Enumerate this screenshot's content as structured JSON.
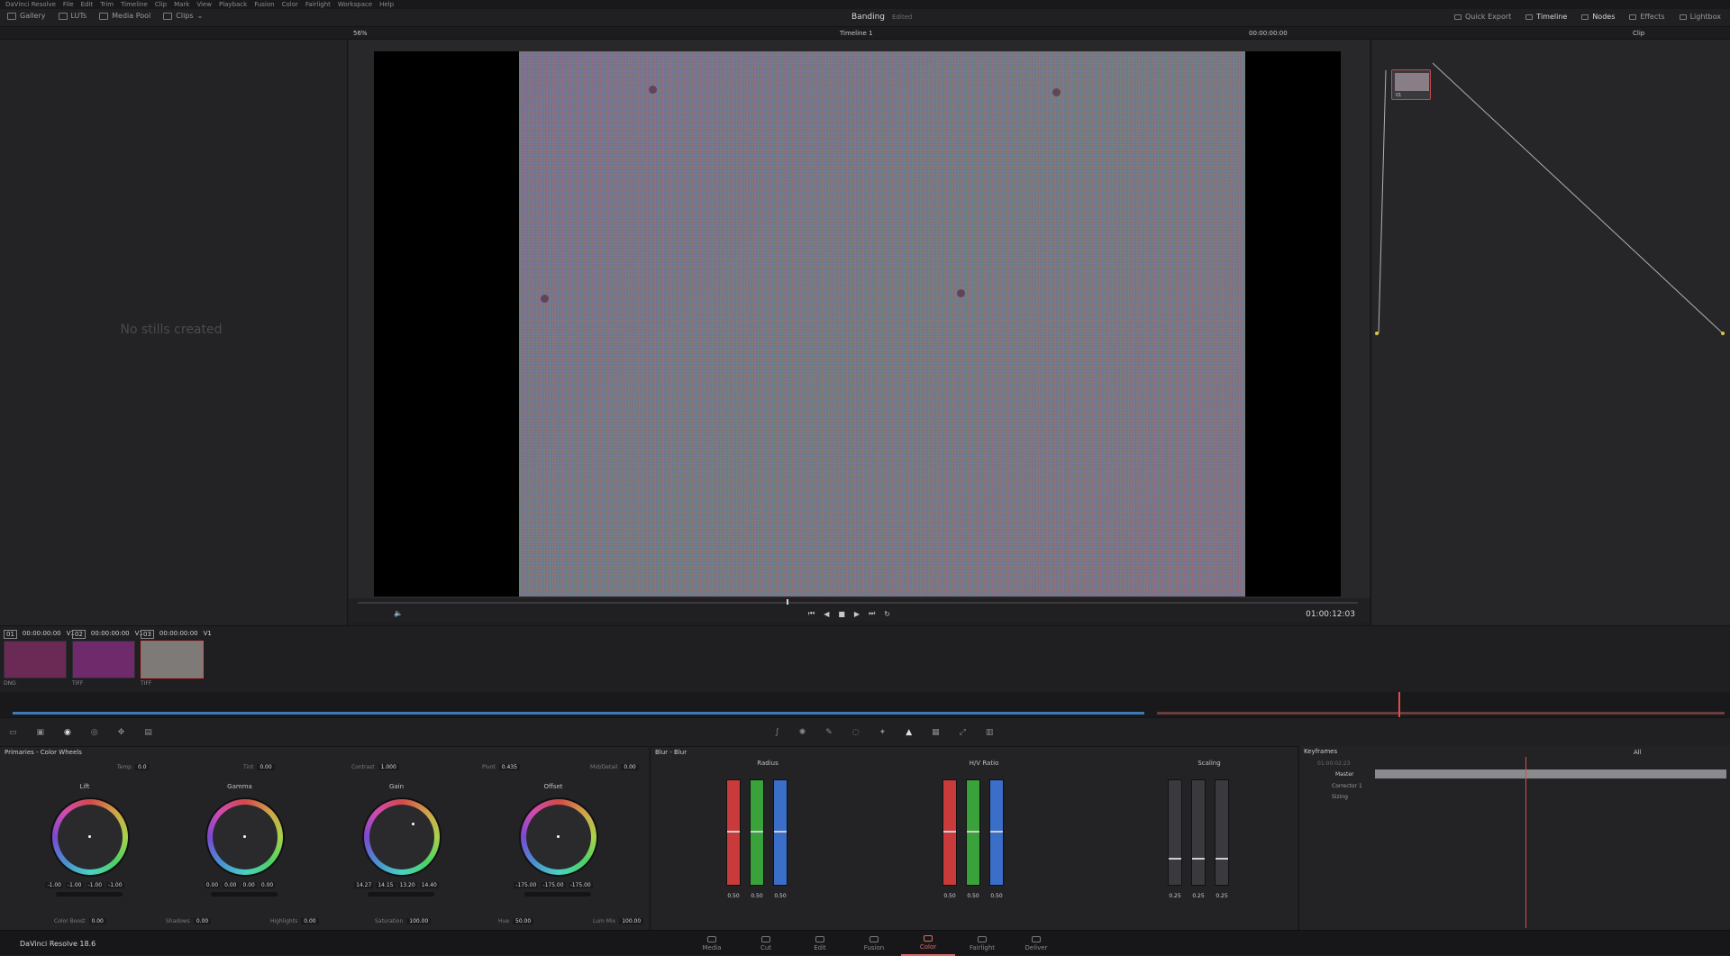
{
  "menu": [
    "DaVinci Resolve",
    "File",
    "Edit",
    "Trim",
    "Timeline",
    "Clip",
    "Mark",
    "View",
    "Playback",
    "Fusion",
    "Color",
    "Fairlight",
    "Workspace",
    "Help"
  ],
  "toolbar": {
    "gallery": "Gallery",
    "luts": "LUTs",
    "media_pool": "Media Pool",
    "clips": "Clips",
    "project_name": "Banding",
    "project_status": "Edited",
    "quick_export": "Quick Export",
    "timeline": "Timeline",
    "nodes": "Nodes",
    "effects": "Effects",
    "lightbox": "Lightbox"
  },
  "subbar": {
    "zoom": "56%",
    "timeline_name": "Timeline 1",
    "timecode": "00:00:00:00",
    "clip_mode": "Clip"
  },
  "gallery": {
    "empty_message": "No stills created"
  },
  "viewer": {
    "timecode": "01:00:12:03"
  },
  "clips": [
    {
      "num": "01",
      "tc": "00:00:00:00",
      "track": "V1",
      "label": "DNG",
      "color": "#6a2a55"
    },
    {
      "num": "02",
      "tc": "00:00:00:00",
      "track": "V1",
      "label": "TIFF",
      "color": "#6e2a6a"
    },
    {
      "num": "03",
      "tc": "00:00:00:00",
      "track": "V1",
      "label": "TIFF",
      "color": "#7d7a78"
    }
  ],
  "primaries": {
    "title": "Primaries - Color Wheels",
    "temp_label": "Temp",
    "temp": "0.0",
    "tint_label": "Tint",
    "tint": "0.00",
    "contrast_label": "Contrast",
    "contrast": "1.000",
    "pivot_label": "Pivot",
    "pivot": "0.435",
    "middetail_label": "Mid/Detail",
    "middetail": "0.00",
    "wheels": [
      {
        "name": "Lift",
        "values": [
          "-1.00",
          "-1.00",
          "-1.00",
          "-1.00"
        ]
      },
      {
        "name": "Gamma",
        "values": [
          "0.00",
          "0.00",
          "0.00",
          "0.00"
        ]
      },
      {
        "name": "Gain",
        "values": [
          "14.27",
          "14.15",
          "13.20",
          "14.40"
        ]
      },
      {
        "name": "Offset",
        "values": [
          "-175.00",
          "-175.00",
          "-175.00"
        ]
      }
    ],
    "colorboost_label": "Color Boost",
    "colorboost": "0.00",
    "shadows_label": "Shadows",
    "shadows": "0.00",
    "highlights_label": "Highlights",
    "highlights": "0.00",
    "saturation_label": "Saturation",
    "saturation": "100.00",
    "hue_label": "Hue",
    "hue": "50.00",
    "lummix_label": "Lum Mix",
    "lummix": "100.00"
  },
  "blur": {
    "title": "Blur - Blur",
    "radius_label": "Radius",
    "radius": [
      "0.50",
      "0.50",
      "0.50"
    ],
    "hv_label": "H/V Ratio",
    "hv": [
      "0.50",
      "0.50",
      "0.50"
    ],
    "scaling_label": "Scaling",
    "scaling": [
      "0.25",
      "0.25",
      "0.25"
    ],
    "channels": [
      "R",
      "G",
      "B"
    ]
  },
  "keyframes": {
    "title": "Keyframes",
    "filter": "All",
    "timecode": "01:00:02:23",
    "rows": [
      "Master",
      "Corrector 1",
      "Sizing"
    ]
  },
  "bottom": {
    "brand": "DaVinci Resolve 18.6",
    "pages": [
      "Media",
      "Cut",
      "Edit",
      "Fusion",
      "Color",
      "Fairlight",
      "Deliver"
    ],
    "active_page": "Color"
  },
  "colors": {
    "accent": "#e06a6a",
    "bg": "#1e1e21"
  }
}
